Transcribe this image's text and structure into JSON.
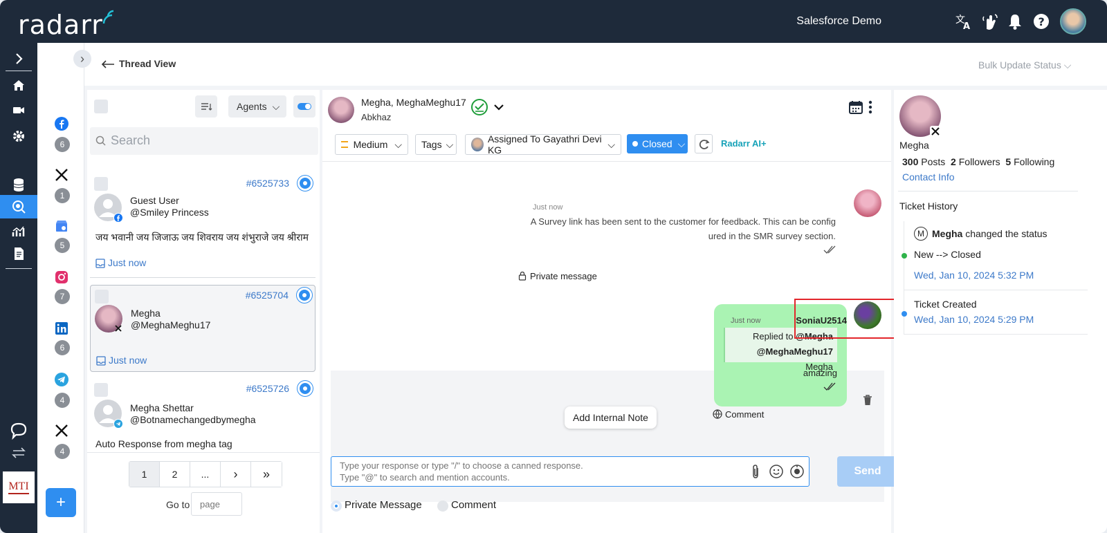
{
  "topbar": {
    "logo": "radarr",
    "org_name": "Salesforce Demo",
    "icons": [
      "translate-icon",
      "hand-wave-icon",
      "bell-icon",
      "help-icon"
    ]
  },
  "header": {
    "back_label": "Thread View",
    "bulk_update_label": "Bulk Update Status"
  },
  "rail": {
    "items": [
      "expand-icon",
      "home-icon",
      "video-icon",
      "settings-icon",
      "inbox-icon",
      "database-icon",
      "analytics-icon",
      "document-icon",
      "chat-bubble-icon",
      "switch-icon"
    ],
    "brand_logo_text": "MTI"
  },
  "channels": [
    {
      "icon": "facebook-icon",
      "count": "6"
    },
    {
      "icon": "x-icon",
      "count": "1"
    },
    {
      "icon": "google-business-icon",
      "count": "5"
    },
    {
      "icon": "instagram-icon",
      "count": "7"
    },
    {
      "icon": "linkedin-icon",
      "count": "6"
    },
    {
      "icon": "telegram-icon",
      "count": "4"
    },
    {
      "icon": "x-icon",
      "count": "4"
    }
  ],
  "list": {
    "agents_label": "Agents",
    "search_placeholder": "Search",
    "tickets": [
      {
        "id": "#6525733",
        "name": "Guest User",
        "handle": "@Smiley Princess",
        "text": "जय भवानी जय जिजाऊ जय शिवराय जय शंभुराजे जय श्रीराम",
        "time": "Just now"
      },
      {
        "id": "#6525704",
        "name": "Megha",
        "handle": "@MeghaMeghu17",
        "text": "",
        "time": "Just now"
      },
      {
        "id": "#6525726",
        "name": "Megha Shettar",
        "handle": "@Botnamechangedbymegha",
        "text": "Auto Response from megha tag",
        "time": ""
      }
    ],
    "pager": [
      "1",
      "2",
      "...",
      "›",
      "»"
    ],
    "goto_label": "Go to",
    "goto_placeholder": "page"
  },
  "conversation": {
    "contact_name": "Megha, MeghaMeghu17",
    "contact_location": "Abkhaz",
    "priority": "Medium",
    "tags": "Tags",
    "assigned": "Assigned To Gayathri Devi KG",
    "status": "Closed",
    "ai_label": "Radarr AI+",
    "message1": {
      "time": "Just now",
      "line1": "A Survey link has been sent to the customer for feedback. This can be config",
      "line2": "ured in the SMR survey section.",
      "type": "Private message"
    },
    "message2": {
      "time": "Just now",
      "author": "SoniaU2514",
      "reply_to_prefix": "Replied to",
      "reply_to_name": "@Megha",
      "reply_to_handle": "@MeghaMeghu17",
      "reply_to_suffix": "Megha",
      "body": "amazing",
      "type": "Comment"
    },
    "add_note_label": "Add Internal Note",
    "composer_placeholder": "Type your response or type \"/\" to choose a canned response.\nType \"@\" to search and mention accounts.",
    "send_label": "Send",
    "mode_private": "Private Message",
    "mode_comment": "Comment"
  },
  "profile": {
    "name": "Megha",
    "posts_count": "300",
    "posts_label": "Posts",
    "followers_count": "2",
    "followers_label": "Followers",
    "following_count": "5",
    "following_label": "Following",
    "contact_info": "Contact Info",
    "history_title": "Ticket History",
    "history": [
      {
        "avatar_letter": "M",
        "actor": "Megha",
        "action": "changed the status",
        "detail": "New --> Closed",
        "time": "Wed, Jan 10, 2024 5:32 PM",
        "dot": "#2fb34a"
      },
      {
        "actor": "",
        "action": "Ticket Created",
        "detail": "",
        "time": "Wed, Jan 10, 2024 5:29 PM",
        "dot": "#2f8ef0"
      }
    ]
  },
  "colors": {
    "accent": "#2f8ef0",
    "topbar": "#1e2a3a",
    "bubble": "#aaf3b3",
    "highlight": "#e3262b"
  }
}
